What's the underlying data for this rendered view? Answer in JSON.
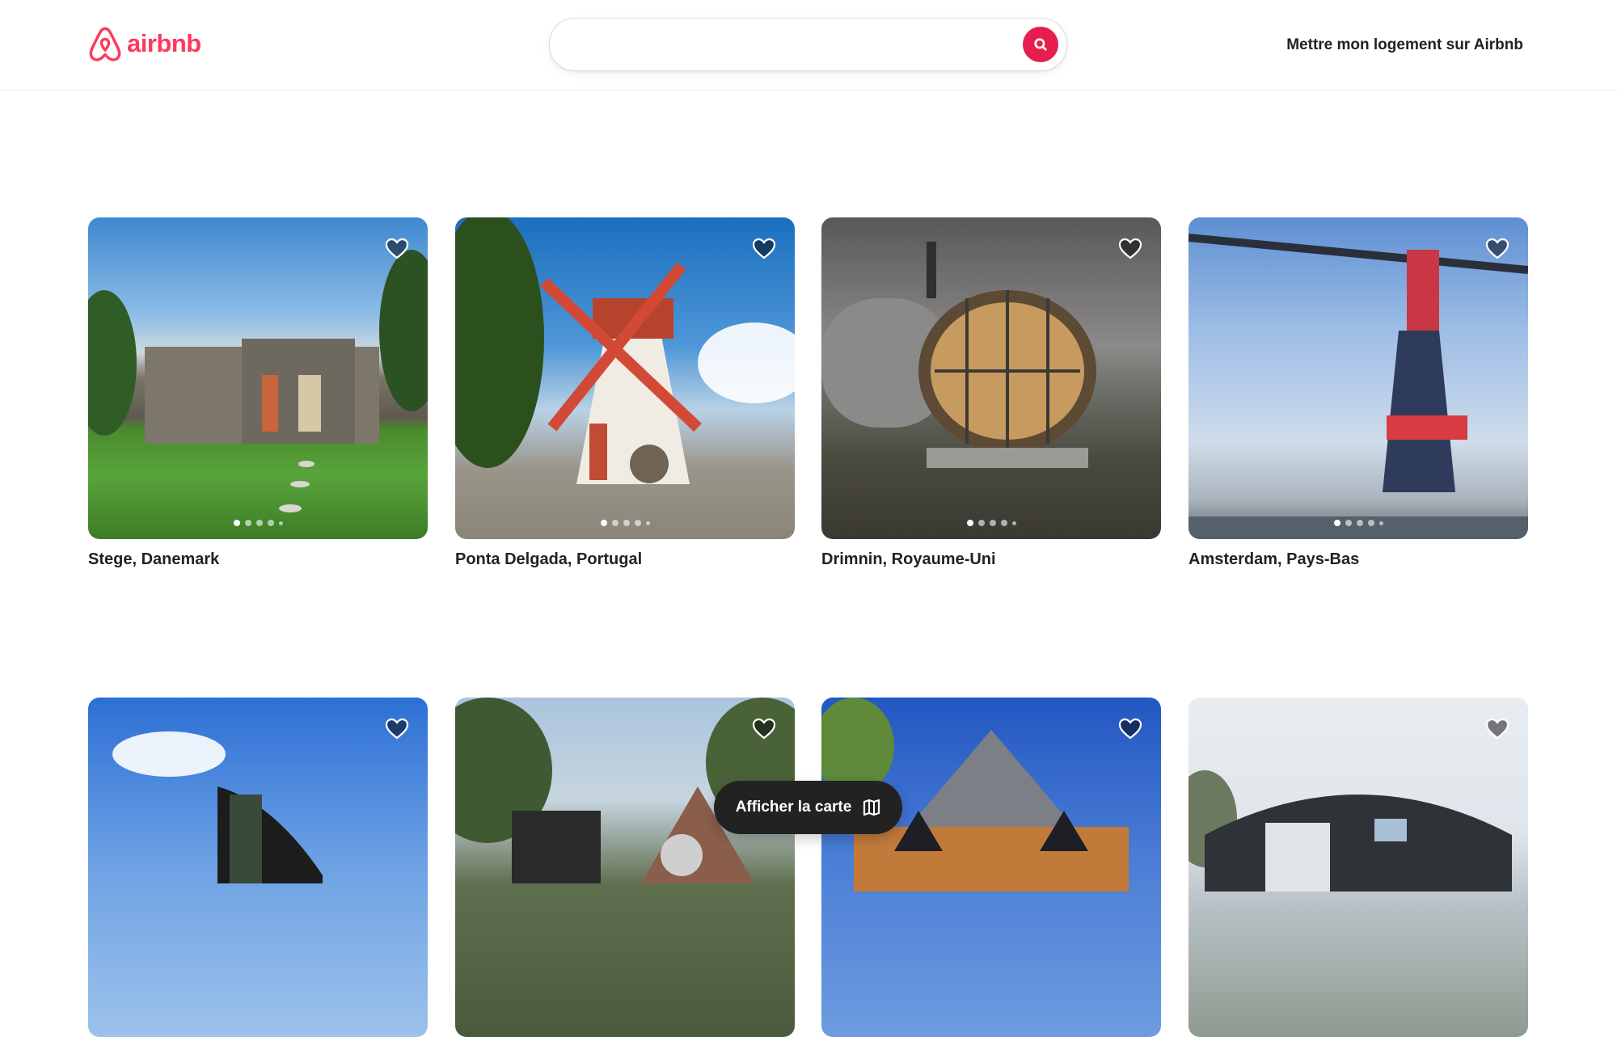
{
  "brand": {
    "name": "airbnb",
    "color": "#ff385c"
  },
  "header": {
    "host_link": "Mettre mon logement sur Airbnb",
    "search_icon": "search-icon"
  },
  "listings": [
    {
      "location": "Stege, Danemark",
      "icon": "heart-icon",
      "photo": "wooden-cabin-garden-photo"
    },
    {
      "location": "Ponta Delgada, Portugal",
      "icon": "heart-icon",
      "photo": "windmill-house-photo"
    },
    {
      "location": "Drimnin, Royaume-Uni",
      "icon": "heart-icon",
      "photo": "glass-pod-photo"
    },
    {
      "location": "Amsterdam, Pays-Bas",
      "icon": "heart-icon",
      "photo": "harbour-crane-photo"
    },
    {
      "location": "",
      "icon": "heart-icon",
      "photo": "black-modern-cabin-photo"
    },
    {
      "location": "",
      "icon": "heart-icon",
      "photo": "garden-huts-photo"
    },
    {
      "location": "",
      "icon": "heart-icon",
      "photo": "wooden-dome-photo"
    },
    {
      "location": "",
      "icon": "heart-icon",
      "photo": "arched-pod-photo"
    }
  ],
  "map_toggle": {
    "label": "Afficher la carte",
    "icon": "map-icon"
  }
}
